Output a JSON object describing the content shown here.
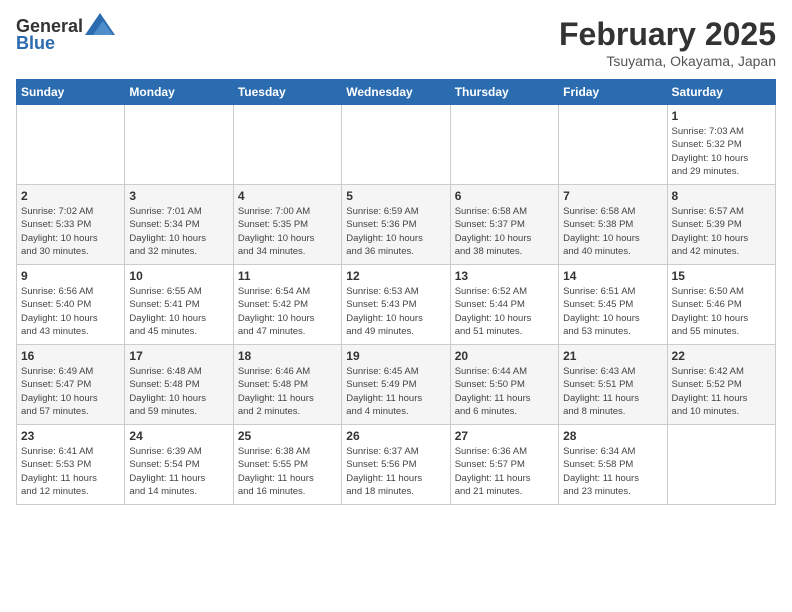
{
  "header": {
    "logo_general": "General",
    "logo_blue": "Blue",
    "month": "February 2025",
    "location": "Tsuyama, Okayama, Japan"
  },
  "days_of_week": [
    "Sunday",
    "Monday",
    "Tuesday",
    "Wednesday",
    "Thursday",
    "Friday",
    "Saturday"
  ],
  "weeks": [
    [
      {
        "day": "",
        "info": ""
      },
      {
        "day": "",
        "info": ""
      },
      {
        "day": "",
        "info": ""
      },
      {
        "day": "",
        "info": ""
      },
      {
        "day": "",
        "info": ""
      },
      {
        "day": "",
        "info": ""
      },
      {
        "day": "1",
        "info": "Sunrise: 7:03 AM\nSunset: 5:32 PM\nDaylight: 10 hours\nand 29 minutes."
      }
    ],
    [
      {
        "day": "2",
        "info": "Sunrise: 7:02 AM\nSunset: 5:33 PM\nDaylight: 10 hours\nand 30 minutes."
      },
      {
        "day": "3",
        "info": "Sunrise: 7:01 AM\nSunset: 5:34 PM\nDaylight: 10 hours\nand 32 minutes."
      },
      {
        "day": "4",
        "info": "Sunrise: 7:00 AM\nSunset: 5:35 PM\nDaylight: 10 hours\nand 34 minutes."
      },
      {
        "day": "5",
        "info": "Sunrise: 6:59 AM\nSunset: 5:36 PM\nDaylight: 10 hours\nand 36 minutes."
      },
      {
        "day": "6",
        "info": "Sunrise: 6:58 AM\nSunset: 5:37 PM\nDaylight: 10 hours\nand 38 minutes."
      },
      {
        "day": "7",
        "info": "Sunrise: 6:58 AM\nSunset: 5:38 PM\nDaylight: 10 hours\nand 40 minutes."
      },
      {
        "day": "8",
        "info": "Sunrise: 6:57 AM\nSunset: 5:39 PM\nDaylight: 10 hours\nand 42 minutes."
      }
    ],
    [
      {
        "day": "9",
        "info": "Sunrise: 6:56 AM\nSunset: 5:40 PM\nDaylight: 10 hours\nand 43 minutes."
      },
      {
        "day": "10",
        "info": "Sunrise: 6:55 AM\nSunset: 5:41 PM\nDaylight: 10 hours\nand 45 minutes."
      },
      {
        "day": "11",
        "info": "Sunrise: 6:54 AM\nSunset: 5:42 PM\nDaylight: 10 hours\nand 47 minutes."
      },
      {
        "day": "12",
        "info": "Sunrise: 6:53 AM\nSunset: 5:43 PM\nDaylight: 10 hours\nand 49 minutes."
      },
      {
        "day": "13",
        "info": "Sunrise: 6:52 AM\nSunset: 5:44 PM\nDaylight: 10 hours\nand 51 minutes."
      },
      {
        "day": "14",
        "info": "Sunrise: 6:51 AM\nSunset: 5:45 PM\nDaylight: 10 hours\nand 53 minutes."
      },
      {
        "day": "15",
        "info": "Sunrise: 6:50 AM\nSunset: 5:46 PM\nDaylight: 10 hours\nand 55 minutes."
      }
    ],
    [
      {
        "day": "16",
        "info": "Sunrise: 6:49 AM\nSunset: 5:47 PM\nDaylight: 10 hours\nand 57 minutes."
      },
      {
        "day": "17",
        "info": "Sunrise: 6:48 AM\nSunset: 5:48 PM\nDaylight: 10 hours\nand 59 minutes."
      },
      {
        "day": "18",
        "info": "Sunrise: 6:46 AM\nSunset: 5:48 PM\nDaylight: 11 hours\nand 2 minutes."
      },
      {
        "day": "19",
        "info": "Sunrise: 6:45 AM\nSunset: 5:49 PM\nDaylight: 11 hours\nand 4 minutes."
      },
      {
        "day": "20",
        "info": "Sunrise: 6:44 AM\nSunset: 5:50 PM\nDaylight: 11 hours\nand 6 minutes."
      },
      {
        "day": "21",
        "info": "Sunrise: 6:43 AM\nSunset: 5:51 PM\nDaylight: 11 hours\nand 8 minutes."
      },
      {
        "day": "22",
        "info": "Sunrise: 6:42 AM\nSunset: 5:52 PM\nDaylight: 11 hours\nand 10 minutes."
      }
    ],
    [
      {
        "day": "23",
        "info": "Sunrise: 6:41 AM\nSunset: 5:53 PM\nDaylight: 11 hours\nand 12 minutes."
      },
      {
        "day": "24",
        "info": "Sunrise: 6:39 AM\nSunset: 5:54 PM\nDaylight: 11 hours\nand 14 minutes."
      },
      {
        "day": "25",
        "info": "Sunrise: 6:38 AM\nSunset: 5:55 PM\nDaylight: 11 hours\nand 16 minutes."
      },
      {
        "day": "26",
        "info": "Sunrise: 6:37 AM\nSunset: 5:56 PM\nDaylight: 11 hours\nand 18 minutes."
      },
      {
        "day": "27",
        "info": "Sunrise: 6:36 AM\nSunset: 5:57 PM\nDaylight: 11 hours\nand 21 minutes."
      },
      {
        "day": "28",
        "info": "Sunrise: 6:34 AM\nSunset: 5:58 PM\nDaylight: 11 hours\nand 23 minutes."
      },
      {
        "day": "",
        "info": ""
      }
    ]
  ]
}
